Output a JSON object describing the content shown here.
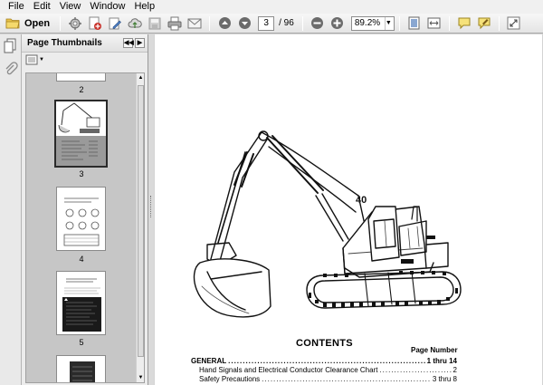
{
  "menubar": {
    "items": [
      "File",
      "Edit",
      "View",
      "Window",
      "Help"
    ]
  },
  "toolbar": {
    "open_label": "Open",
    "current_page": "3",
    "page_total": "/ 96",
    "zoom": "89.2%"
  },
  "panel": {
    "title": "Page Thumbnails",
    "thumbnails": [
      {
        "label": "2"
      },
      {
        "label": "3"
      },
      {
        "label": "4"
      },
      {
        "label": "5"
      }
    ]
  },
  "document": {
    "badge_number": "40",
    "contents_title": "CONTENTS",
    "page_number_header": "Page Number",
    "toc": [
      {
        "title": "GENERAL",
        "pages": "1  thru  14",
        "bold": true
      },
      {
        "title": "Hand Signals and Electrical Conductor Clearance Chart",
        "pages": "2",
        "bold": false
      },
      {
        "title": "Safety Precautions",
        "pages": "3  thru  8",
        "bold": false
      }
    ]
  }
}
